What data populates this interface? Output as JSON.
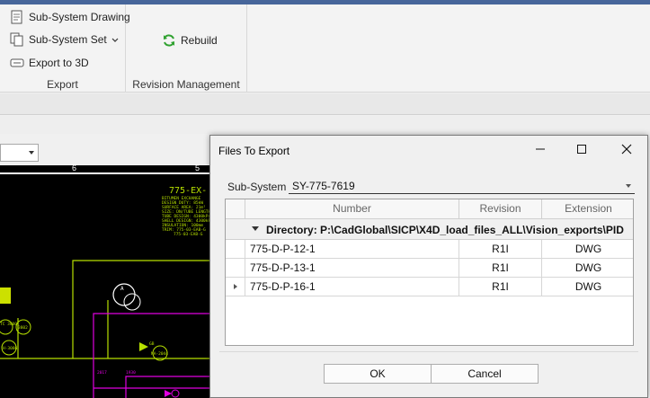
{
  "ribbon": {
    "export_group": {
      "label": "Export",
      "items": [
        "Sub-System Drawing",
        "Sub-System Set",
        "Export to 3D"
      ]
    },
    "revision_group": {
      "label": "Revision Management",
      "rebuild_label": "Rebuild"
    }
  },
  "drawing": {
    "ruler_ticks": [
      "6",
      "5"
    ],
    "equipment_tag": "775-EX-",
    "notes": [
      "BITUMEN EXCHANGE",
      "DESIGN DUTY: 85kW",
      "SURFACE AREA: 21m²",
      "SIZE: DN/TUBE LENGTH",
      "TUBE DESIGN: 4300kPa",
      "SHELL DESIGN: 4300kPa",
      "INSULATION: 100mm",
      "TRIM: 775-03-EAB-G",
      "775-03-EAB-G"
    ],
    "valve_tags": [
      "A",
      "TC 3800",
      "3802",
      "H-3086",
      "GB",
      "2017",
      "NA-2044",
      "1930"
    ]
  },
  "dialog": {
    "title": "Files To Export",
    "subsystem_label": "Sub-System",
    "subsystem_value": "SY-775-7619",
    "columns": [
      "Number",
      "Revision",
      "Extension"
    ],
    "group_header": "Directory: P:\\CadGlobal\\SICP\\X4D_load_files_ALL\\Vision_exports\\PID",
    "rows": [
      {
        "number": "775-D-P-12-1",
        "revision": "R1I",
        "extension": "DWG"
      },
      {
        "number": "775-D-P-13-1",
        "revision": "R1I",
        "extension": "DWG"
      },
      {
        "number": "775-D-P-16-1",
        "revision": "R1I",
        "extension": "DWG"
      }
    ],
    "ok_label": "OK",
    "cancel_label": "Cancel"
  },
  "colors": {
    "accent_bar": "#47669a",
    "cad_background": "#000000",
    "cad_green": "#b7e000",
    "cad_magenta": "#e000e0",
    "rebuild_icon": "#2fa12f"
  }
}
